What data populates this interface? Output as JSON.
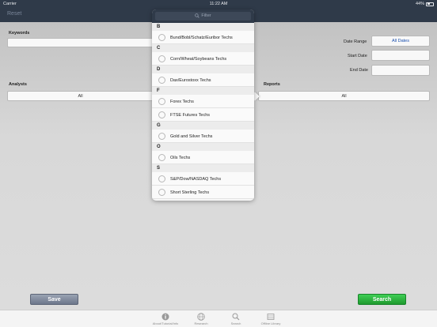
{
  "status_bar": {
    "carrier": "Carrier",
    "time": "11:22 AM",
    "battery": "44%",
    "battery_level": 0.44
  },
  "nav": {
    "reset_label": "Reset"
  },
  "form": {
    "keywords_label": "Keywords",
    "analysts_label": "Analysts",
    "analysts_value": "All",
    "reports_label": "Reports",
    "reports_value": "All",
    "date_range_label": "Date Range",
    "date_range_value": "All Dates",
    "start_date_label": "Start Date",
    "end_date_label": "End Date"
  },
  "buttons": {
    "save": "Save",
    "search": "Search"
  },
  "popover": {
    "filter_placeholder": "Filter",
    "sections": [
      {
        "letter": "B",
        "items": [
          "Bund/Bobl/Schatz/Euribor Techs"
        ]
      },
      {
        "letter": "C",
        "items": [
          "Corn/Wheat/Soybeans Techs"
        ]
      },
      {
        "letter": "D",
        "items": [
          "Dax/Eurostoxx Techs"
        ]
      },
      {
        "letter": "F",
        "items": [
          "Forex Techs",
          "FTSE Futures Techs"
        ]
      },
      {
        "letter": "G",
        "items": [
          "Gold and Silver Techs"
        ]
      },
      {
        "letter": "O",
        "items": [
          "Oils Techs"
        ]
      },
      {
        "letter": "S",
        "items": [
          "S&P/Dow/NASDAQ Techs",
          "Short Sterling Techs"
        ]
      }
    ]
  },
  "tabs": [
    {
      "label": "About/Tutorial/Info",
      "icon": "info-icon"
    },
    {
      "label": "Research",
      "icon": "globe-icon"
    },
    {
      "label": "Search",
      "icon": "search-icon"
    },
    {
      "label": "Offline Library",
      "icon": "library-icon"
    }
  ],
  "colors": {
    "nav": "#2f3a49",
    "search_button": "#2eb540",
    "save_button": "#7b8599"
  }
}
